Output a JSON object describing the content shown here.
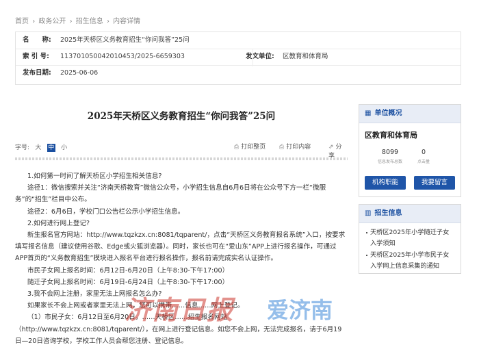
{
  "breadcrumb": [
    "首页",
    "政务公开",
    "招生信息",
    "内容详情"
  ],
  "breadcrumb_sep": "›",
  "meta": {
    "name_label": "名　　称:",
    "name_value": "2025年天桥区义务教育招生“你问我答”25问",
    "index_label": "索 引 号:",
    "index_value": "113701050042010453/2025-6659303",
    "unit_label": "发文单位:",
    "unit_value": "区教育和体育局",
    "date_label": "发布日期:",
    "date_value": "2025-06-06"
  },
  "article": {
    "title": "2025年天桥区义务教育招生“你问我答”25问",
    "fontsize_label": "字号:",
    "fontsize_options": [
      "大",
      "中",
      "小"
    ],
    "fontsize_active": "中",
    "print_page": "打印整页",
    "print_content": "打印内容",
    "share": "分享",
    "paragraphs": [
      "1.如何第一时间了解天桥区小学招生相关信息?",
      "途径1：微信搜索并关注“济南天桥教育”微信公众号，小学招生信息自6月6日将在公众号下方一栏“微服务”的“招生”栏目中公布。",
      "途径2：6月6日，学校门口公告栏公示小学招生信息。",
      "2.如何进行网上登记?",
      "新生报名官方网站：http://www.tqzkzx.cn:8081/tqparent/，点击“天桥区义务教育报名系统”入口，按要求填写报名信息（建议使用谷歌、Edge或火狐浏览器）。同时，家长也可在“爱山东”APP上进行报名操作，可通过APP首页的“义务教育招生”模块进入报名平台进行报名操作，报名前请完成实名认证操作。",
      "市民子女网上报名时间：6月12日-6月20日（上午8:30-下午17:00）",
      "随迁子女网上报名时间：6月19日-6月24日（上午8:30-下午17:00）",
      "3.我不会网上注册，家里无法上网报名怎么办?",
      "如果家长不会上网或者家里无法上网，您可以携带……信息……网上登记。",
      "（1）市民子女：6月12日至6月20日，……天桥区……招生报名网站（http://www.tqzkzx.cn:8081/tqparent/），在网上进行登记信息。如您不会上网，无法完成报名，请于6月19日—20日咨询学校，学校工作人员会帮您注册、登记信息。"
    ]
  },
  "sidebar": {
    "overview_title": "单位概况",
    "overview_icon": "building-icon",
    "org_name": "区教育和体育局",
    "stats": [
      {
        "value": "8099",
        "label": "信息发布总数"
      },
      {
        "value": "0",
        "label": "点击量"
      }
    ],
    "btn_duties": "机构职能",
    "btn_message": "我要留言",
    "news_title": "招生信息",
    "news_icon": "bars-icon",
    "news_items": [
      "天桥区2025年小学随迁子女入学须知",
      "天桥区2025年小学市民子女入学网上信息采集的通知"
    ]
  },
  "watermark": {
    "left": "济南日报",
    "right": "爱济南"
  },
  "colors": {
    "accent": "#1f55a8",
    "sidebar_header": "#e8edf6",
    "watermark_red": "#c8281e",
    "watermark_blue": "#2e7fd6"
  }
}
